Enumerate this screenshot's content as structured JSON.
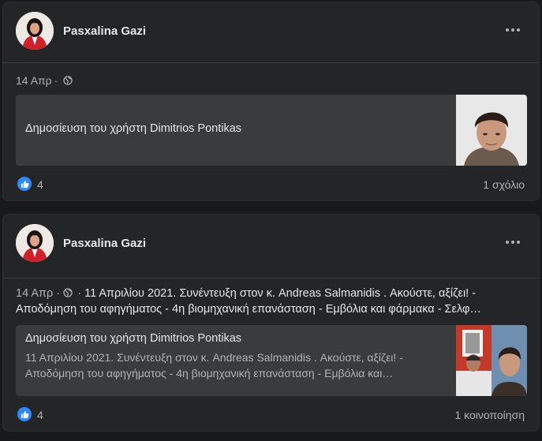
{
  "posts": [
    {
      "author": "Pasxalina Gazi",
      "date": "14 Απρ",
      "separator": "·",
      "privacy_icon": "globe-icon",
      "text": "",
      "shared_title": "Δημοσίευση του χρήστη Dimitrios Pontikas",
      "shared_subtitle": "",
      "likes": "4",
      "right_stat": "1 σχόλιο"
    },
    {
      "author": "Pasxalina Gazi",
      "date": "14 Απρ",
      "separator": "·",
      "privacy_icon": "globe-icon",
      "text": "11 Απριλίου 2021. Συνέντευξη στον κ. Andreas Salmanidis . Ακούστε, αξίζει! - Αποδόμηση του αφηγήματος - 4η βιομηχανική επανάσταση - Εμβόλια και φάρμακα - Σελφ…",
      "shared_title": "Δημοσίευση του χρήστη Dimitrios Pontikas",
      "shared_subtitle": "11 Απριλίου 2021. Συνέντευξη στον κ. Andreas Salmanidis . Ακούστε, αξίζει! - Αποδόμηση του αφηγήματος - 4η βιομηχανική επανάσταση - Εμβόλια και…",
      "likes": "4",
      "right_stat": "1 κοινοποίηση"
    }
  ],
  "colors": {
    "background": "#18191a",
    "card": "#242526",
    "shared_box": "#3a3b3c",
    "like_blue": "#2d88ff",
    "secondary_text": "#b0b3b8"
  }
}
